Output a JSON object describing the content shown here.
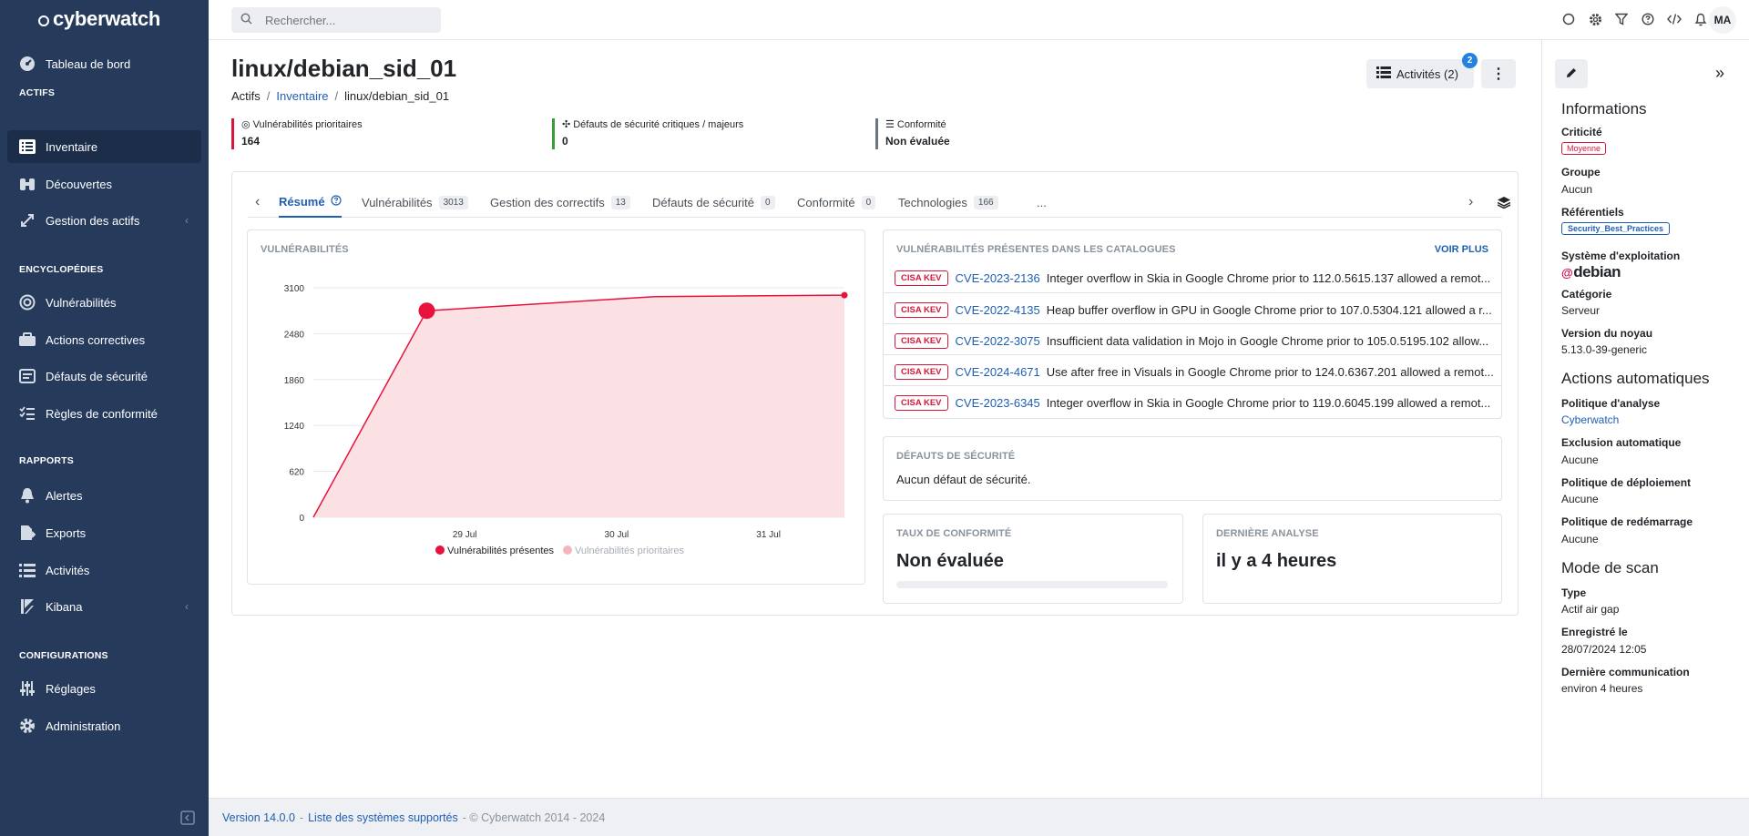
{
  "brand": {
    "name": "cyberwatch"
  },
  "sidebar": {
    "items": [
      {
        "label": "Tableau de bord"
      },
      {
        "label": "Inventaire"
      },
      {
        "label": "Découvertes"
      },
      {
        "label": "Gestion des actifs"
      },
      {
        "label": "Vulnérabilités"
      },
      {
        "label": "Actions correctives"
      },
      {
        "label": "Défauts de sécurité"
      },
      {
        "label": "Règles de conformité"
      },
      {
        "label": "Alertes"
      },
      {
        "label": "Exports"
      },
      {
        "label": "Activités"
      },
      {
        "label": "Kibana"
      },
      {
        "label": "Réglages"
      },
      {
        "label": "Administration"
      }
    ],
    "sections": {
      "actifs": "ACTIFS",
      "encyclopedies": "ENCYCLOPÉDIES",
      "rapports": "RAPPORTS",
      "configurations": "CONFIGURATIONS"
    }
  },
  "topbar": {
    "search_placeholder": "Rechercher...",
    "avatar": "MA"
  },
  "page": {
    "title": "linux/debian_sid_01",
    "breadcrumb": [
      "Actifs",
      "Inventaire",
      "linux/debian_sid_01"
    ],
    "activities_button": "Activités (2)",
    "activities_count": "2",
    "more_button": "⋮"
  },
  "stats": [
    {
      "label": "Vulnérabilités prioritaires",
      "value": "164"
    },
    {
      "label": "Défauts de sécurité critiques / majeurs",
      "value": "0"
    },
    {
      "label": "Conformité",
      "value": "Non évaluée"
    }
  ],
  "tabs": [
    {
      "label": "Résumé",
      "count": ""
    },
    {
      "label": "Vulnérabilités",
      "count": "3013"
    },
    {
      "label": "Gestion des correctifs",
      "count": "13"
    },
    {
      "label": "Défauts de sécurité",
      "count": "0"
    },
    {
      "label": "Conformité",
      "count": "0"
    },
    {
      "label": "Technologies",
      "count": "166"
    },
    {
      "label": "...",
      "count": ""
    }
  ],
  "chart_panel": {
    "title": "VULNÉRABILITÉS"
  },
  "chart_data": {
    "type": "area",
    "title": "",
    "x_ticks": [
      "29 Jul",
      "30 Jul",
      "31 Jul"
    ],
    "ylim": [
      0,
      3100
    ],
    "y_ticks": [
      0,
      620,
      1240,
      1860,
      2480,
      3100
    ],
    "series": [
      {
        "name": "Vulnérabilités présentes",
        "color": "#e8133d",
        "fill": "#fbe0e4",
        "points": [
          {
            "x": "28 Jul 12:05",
            "y": 0
          },
          {
            "x": "29 Jul 06:00",
            "y": 2790
          },
          {
            "x": "30 Jul 18:00",
            "y": 2980
          },
          {
            "x": "31 Jul 24:00",
            "y": 3000
          }
        ]
      },
      {
        "name": "Vulnérabilités prioritaires",
        "color": "#f4b5c0",
        "points": []
      }
    ],
    "grid": true,
    "legend": "bottom"
  },
  "catalog_panel": {
    "title": "VULNÉRABILITÉS PRÉSENTES DANS LES CATALOGUES",
    "more": "VOIR PLUS",
    "rows": [
      {
        "tag": "CISA KEV",
        "cve": "CVE-2023-2136",
        "desc": "Integer overflow in Skia in Google Chrome prior to 112.0.5615.137 allowed a remot..."
      },
      {
        "tag": "CISA KEV",
        "cve": "CVE-2022-4135",
        "desc": "Heap buffer overflow in GPU in Google Chrome prior to 107.0.5304.121 allowed a r..."
      },
      {
        "tag": "CISA KEV",
        "cve": "CVE-2022-3075",
        "desc": "Insufficient data validation in Mojo in Google Chrome prior to 105.0.5195.102 allow..."
      },
      {
        "tag": "CISA KEV",
        "cve": "CVE-2024-4671",
        "desc": "Use after free in Visuals in Google Chrome prior to 124.0.6367.201 allowed a remot..."
      },
      {
        "tag": "CISA KEV",
        "cve": "CVE-2023-6345",
        "desc": "Integer overflow in Skia in Google Chrome prior to 119.0.6045.199 allowed a remot..."
      }
    ]
  },
  "security_panel": {
    "title": "DÉFAUTS DE SÉCURITÉ",
    "text": "Aucun défaut de sécurité."
  },
  "compliance_panel": {
    "title": "TAUX DE CONFORMITÉ",
    "value": "Non évaluée"
  },
  "analysis_panel": {
    "title": "DERNIÈRE ANALYSE",
    "value": "il y a 4 heures"
  },
  "info": {
    "informations": "Informations",
    "criticite_label": "Criticité",
    "criticite_value": "Moyenne",
    "groupe_label": "Groupe",
    "groupe_value": "Aucun",
    "referentiels_label": "Référentiels",
    "referentiels_value": "Security_Best_Practices",
    "os_label": "Système d'exploitation",
    "os_value": "debian",
    "categorie_label": "Catégorie",
    "categorie_value": "Serveur",
    "noyau_label": "Version du noyau",
    "noyau_value": "5.13.0-39-generic",
    "actions_title": "Actions automatiques",
    "analyse_label": "Politique d'analyse",
    "analyse_value": "Cyberwatch",
    "exclusion_label": "Exclusion automatique",
    "exclusion_value": "Aucune",
    "deploiement_label": "Politique de déploiement",
    "deploiement_value": "Aucune",
    "redemarrage_label": "Politique de redémarrage",
    "redemarrage_value": "Aucune",
    "scan_title": "Mode de scan",
    "type_label": "Type",
    "type_value": "Actif air gap",
    "enregistre_label": "Enregistré le",
    "enregistre_value": "28/07/2024 12:05",
    "comm_label": "Dernière communication",
    "comm_value": "environ 4 heures"
  },
  "footer": {
    "version": "Version 14.0.0",
    "sep": "-",
    "systems": "Liste des systèmes supportés",
    "copyright": "- © Cyberwatch 2014 - 2024"
  }
}
